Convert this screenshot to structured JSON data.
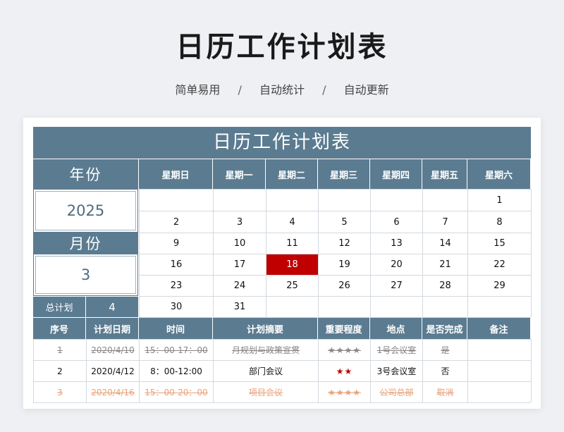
{
  "page": {
    "title": "日历工作计划表",
    "subtitle_items": [
      "简单易用",
      "自动统计",
      "自动更新"
    ],
    "separator": "/"
  },
  "sheet": {
    "banner": "日历工作计划表",
    "year_label": "年份",
    "year_value": "2025",
    "month_label": "月份",
    "month_value": "3",
    "total_label": "总计划",
    "total_value": "4",
    "weekdays": [
      "星期日",
      "星期一",
      "星期二",
      "星期三",
      "星期四",
      "星期五",
      "星期六"
    ],
    "calendar_rows": [
      [
        "",
        "",
        "",
        "",
        "",
        "",
        "1"
      ],
      [
        "2",
        "3",
        "4",
        "5",
        "6",
        "7",
        "8"
      ],
      [
        "9",
        "10",
        "11",
        "12",
        "13",
        "14",
        "15"
      ],
      [
        "16",
        "17",
        "18",
        "19",
        "20",
        "21",
        "22"
      ],
      [
        "23",
        "24",
        "25",
        "26",
        "27",
        "28",
        "29"
      ],
      [
        "30",
        "31",
        "",
        "",
        "",
        "",
        ""
      ]
    ],
    "highlighted_day": "18",
    "highlight_color": "#c00000",
    "header_color": "#5b7b90"
  },
  "plan_table": {
    "columns": [
      "序号",
      "计划日期",
      "时间",
      "计划摘要",
      "重要程度",
      "地点",
      "是否完成",
      "备注"
    ],
    "rows": [
      {
        "no": "1",
        "date": "2020/4/10",
        "time": "15：00-17：00",
        "summary": "月规划与政策宣贯",
        "importance": "★★★★",
        "location": "1号会议室",
        "done": "是",
        "note": "",
        "status": "done"
      },
      {
        "no": "2",
        "date": "2020/4/12",
        "time": "8：00-12:00",
        "summary": "部门会议",
        "importance": "★★",
        "location": "3号会议室",
        "done": "否",
        "note": "",
        "status": "pending"
      },
      {
        "no": "3",
        "date": "2020/4/16",
        "time": "15：00-20：00",
        "summary": "项目会议",
        "importance": "★★★★",
        "location": "公司总部",
        "done": "取消",
        "note": "",
        "status": "cancelled"
      }
    ]
  }
}
